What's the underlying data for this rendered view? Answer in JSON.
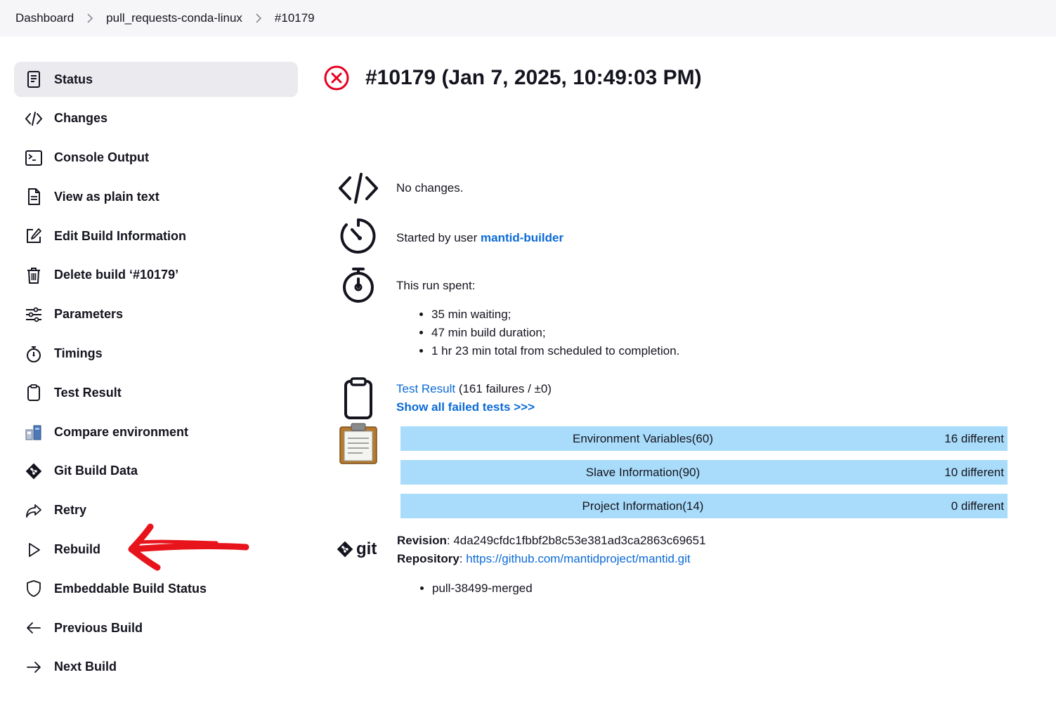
{
  "breadcrumb": [
    "Dashboard",
    "pull_requests-conda-linux",
    "#10179"
  ],
  "sidebar": {
    "items": [
      {
        "label": "Status",
        "icon": "status-icon",
        "active": true
      },
      {
        "label": "Changes",
        "icon": "code-icon"
      },
      {
        "label": "Console Output",
        "icon": "terminal-icon"
      },
      {
        "label": "View as plain text",
        "icon": "document-icon"
      },
      {
        "label": "Edit Build Information",
        "icon": "edit-icon"
      },
      {
        "label": "Delete build ‘#10179’",
        "icon": "trash-icon"
      },
      {
        "label": "Parameters",
        "icon": "sliders-icon"
      },
      {
        "label": "Timings",
        "icon": "stopwatch-icon"
      },
      {
        "label": "Test Result",
        "icon": "clipboard-icon"
      },
      {
        "label": "Compare environment",
        "icon": "compare-icon"
      },
      {
        "label": "Git Build Data",
        "icon": "git-icon"
      },
      {
        "label": "Retry",
        "icon": "share-arrow-icon"
      },
      {
        "label": "Rebuild",
        "icon": "play-icon"
      },
      {
        "label": "Embeddable Build Status",
        "icon": "shield-icon"
      },
      {
        "label": "Previous Build",
        "icon": "arrow-left-icon"
      },
      {
        "label": "Next Build",
        "icon": "arrow-right-icon"
      }
    ]
  },
  "build": {
    "title": "#10179 (Jan 7, 2025, 10:49:03 PM)",
    "status_color": "#e6001f"
  },
  "changes": {
    "text": "No changes."
  },
  "started": {
    "prefix": "Started by user ",
    "user": "mantid-builder"
  },
  "timing": {
    "heading": "This run spent:",
    "items": [
      "35 min waiting;",
      "47 min build duration;",
      "1 hr 23 min total from scheduled to completion."
    ]
  },
  "tests": {
    "link": "Test Result",
    "summary": " (161 failures / ±0)",
    "show_failed": "Show all failed tests >>>"
  },
  "environment": {
    "rows": [
      {
        "label": "Environment Variables(60)",
        "diff": "16 different"
      },
      {
        "label": "Slave Information(90)",
        "diff": "10 different"
      },
      {
        "label": "Project Information(14)",
        "diff": "0 different"
      }
    ]
  },
  "git": {
    "logo_text": "git",
    "revision_label": "Revision",
    "revision": "4da249cfdc1fbbf2b8c53e381ad3ca2863c69651",
    "repository_label": "Repository",
    "repository": "https://github.com/mantidproject/mantid.git",
    "branches": [
      "pull-38499-merged"
    ]
  },
  "colors": {
    "link": "#0b6ad6",
    "table_bg": "#a9dcfa",
    "annotation": "#e8141c"
  }
}
